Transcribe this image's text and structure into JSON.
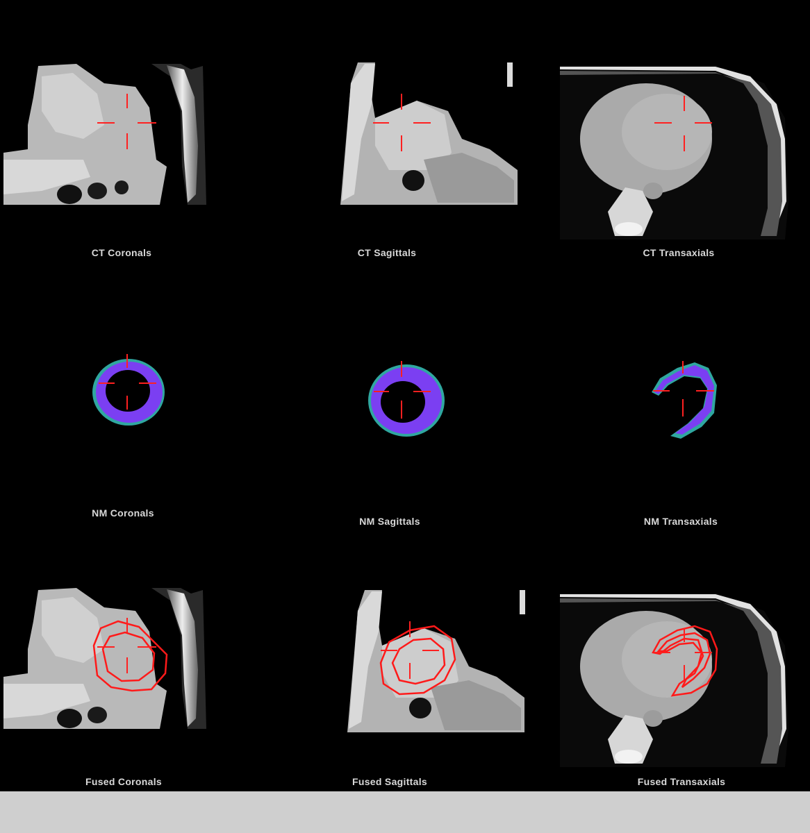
{
  "viewer": {
    "rows": [
      {
        "row": "ct",
        "panels": [
          {
            "label": "CT Coronals",
            "view": "coronal",
            "modality": "ct"
          },
          {
            "label": "CT Sagittals",
            "view": "sagittal",
            "modality": "ct"
          },
          {
            "label": "CT Transaxials",
            "view": "transaxial",
            "modality": "ct"
          }
        ]
      },
      {
        "row": "nm",
        "panels": [
          {
            "label": "NM Coronals",
            "view": "coronal",
            "modality": "nm"
          },
          {
            "label": "NM Sagittals",
            "view": "sagittal",
            "modality": "nm"
          },
          {
            "label": "NM Transaxials",
            "view": "transaxial",
            "modality": "nm"
          }
        ]
      },
      {
        "row": "fused",
        "panels": [
          {
            "label": "Fused Coronals",
            "view": "coronal",
            "modality": "fused"
          },
          {
            "label": "Fused Sagittals",
            "view": "sagittal",
            "modality": "fused"
          },
          {
            "label": "Fused Transaxials",
            "view": "transaxial",
            "modality": "fused"
          }
        ]
      }
    ]
  },
  "colors": {
    "background": "#000000",
    "crosshair": "#ff2020",
    "contour": "#ff1a1a",
    "nm_ring": "#7b3ff2",
    "nm_edge": "#2fa7a0",
    "label_text": "#d9d9d9",
    "status_bar": "#cfcfcf"
  }
}
